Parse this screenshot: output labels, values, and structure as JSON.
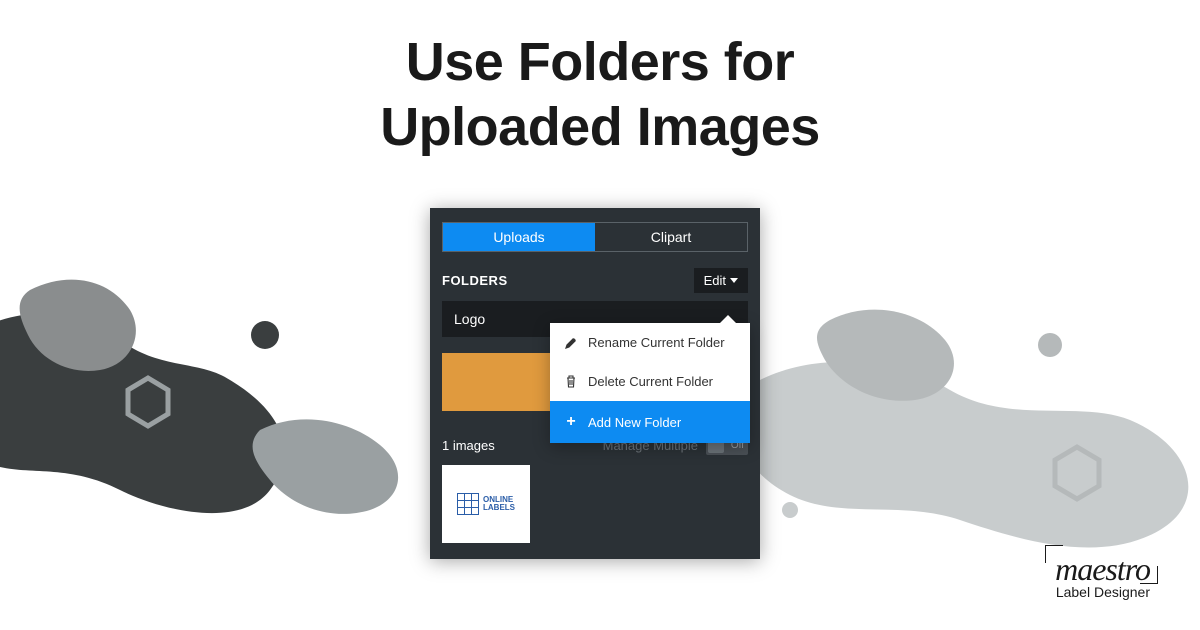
{
  "headline": {
    "line1": "Use Folders for",
    "line2": "Uploaded Images"
  },
  "panel": {
    "tabs": {
      "uploads": "Uploads",
      "clipart": "Clipart"
    },
    "folders_label": "FOLDERS",
    "edit_label": "Edit",
    "current_folder": "Logo",
    "upload_button": "+",
    "image_count": "1 images",
    "manage_label": "Manage Multiple",
    "toggle_label": "Off",
    "thumb_text_top": "ONLINE",
    "thumb_text_bottom": "LABELS"
  },
  "dropdown": {
    "rename": "Rename Current Folder",
    "delete": "Delete Current Folder",
    "add": "Add New Folder"
  },
  "logo": {
    "main": "maestro",
    "sub": "Label Designer"
  }
}
